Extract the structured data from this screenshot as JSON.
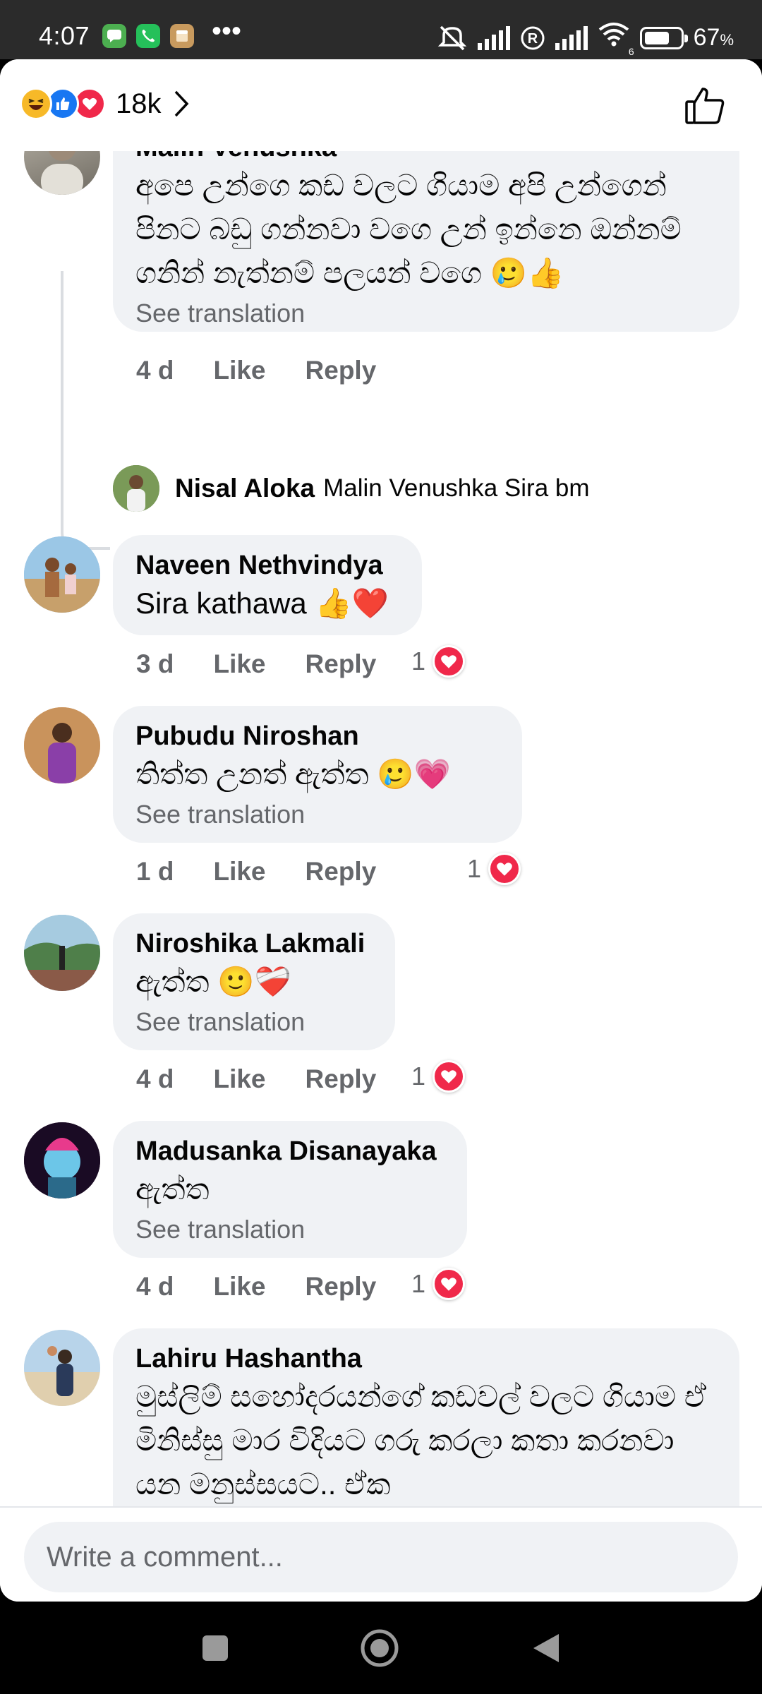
{
  "status": {
    "time": "4:07",
    "dots": "•••",
    "battery": "67",
    "battery_unit": "%",
    "battery_level": 0.67,
    "net_type": "6"
  },
  "header": {
    "reaction_count": "18k",
    "reactions": [
      "haha-icon",
      "like-icon",
      "love-icon"
    ]
  },
  "comments": [
    {
      "name": "Malin Venushka",
      "text": "අපෙ උන්ගෙ කඩ වලට ගියාම අපි උන්ගෙන් පිනට බඩු ගන්නවා වගෙ උන් ඉන්නෙ ඔන්නම් ගනින් නැත්නම් පලයන් වගෙ 🥲👍",
      "see_translation": "See translation",
      "time": "4 d",
      "like": "Like",
      "reply": "Reply"
    },
    {
      "name": "Naveen Nethvindya",
      "text": "Sira kathawa 👍❤️",
      "time": "3 d",
      "like": "Like",
      "reply": "Reply",
      "reaction_count": "1"
    },
    {
      "name": "Pubudu Niroshan",
      "text": "තිත්ත උනත් ඇත්ත 🥲💗",
      "see_translation": "See translation",
      "time": "1 d",
      "like": "Like",
      "reply": "Reply",
      "reaction_count": "1"
    },
    {
      "name": "Niroshika Lakmali",
      "text": "ඇත්ත 🙂❤️‍🩹",
      "see_translation": "See translation",
      "time": "4 d",
      "like": "Like",
      "reply": "Reply",
      "reaction_count": "1"
    },
    {
      "name": "Madusanka Disanayaka",
      "text": "ඇත්ත",
      "see_translation": "See translation",
      "time": "4 d",
      "like": "Like",
      "reply": "Reply",
      "reaction_count": "1"
    },
    {
      "name": "Lahiru Hashantha",
      "text": "මුස්ලිම් සහෝදරයන්ගේ කඩවල් වලට ගියාම ඒ මිනිස්සු මාර විදියට ගරු කරලා කතා කරනවා යන මනුස්සයට.. ඒක"
    }
  ],
  "reply": {
    "name": "Nisal Aloka",
    "text": "Malin Venushka Sira bm"
  },
  "composer": {
    "placeholder": "Write a comment..."
  },
  "colors": {
    "bubble": "#f0f2f5",
    "meta": "#65676b",
    "love": "#f0284a",
    "like": "#1877f2",
    "haha": "#f7b928"
  }
}
